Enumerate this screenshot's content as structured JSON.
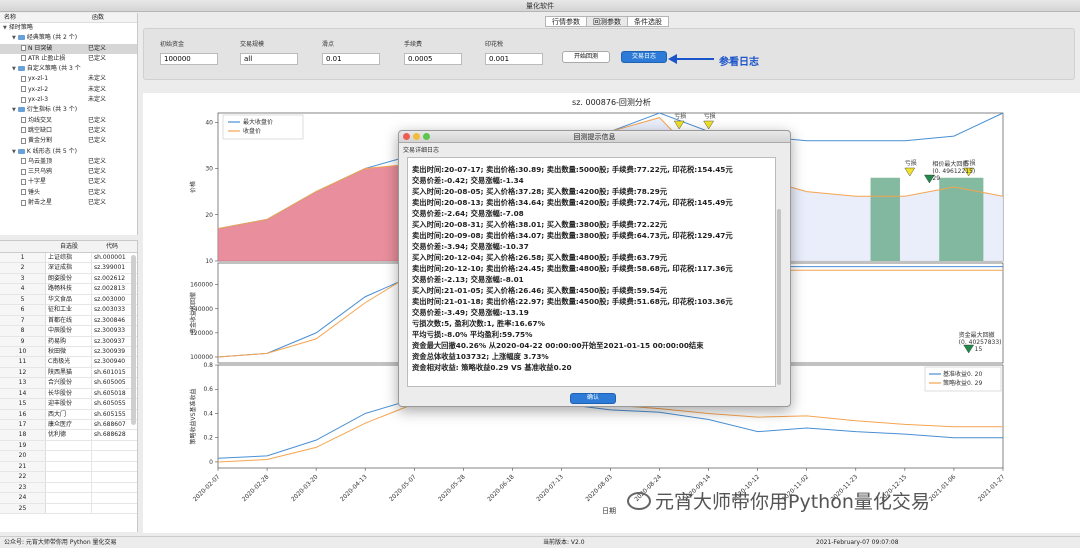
{
  "window": {
    "title": "量化软件"
  },
  "left_tree": {
    "header_name": "名称",
    "header_func": "函数",
    "rows": [
      {
        "level": 0,
        "label": "择时策略",
        "status": "",
        "folder": false,
        "arrow": "▼"
      },
      {
        "level": 1,
        "label": "经典策略 (共 2 个)",
        "status": "",
        "folder": true,
        "arrow": "▼"
      },
      {
        "level": 2,
        "label": "N 日突破",
        "status": "已定义",
        "folder": false,
        "arrow": ""
      },
      {
        "level": 2,
        "label": "ATR 止盈止损",
        "status": "已定义",
        "folder": false,
        "arrow": ""
      },
      {
        "level": 1,
        "label": "自定义策略 (共 3 个",
        "status": "",
        "folder": true,
        "arrow": "▼"
      },
      {
        "level": 2,
        "label": "yx-zl-1",
        "status": "未定义",
        "folder": false,
        "arrow": ""
      },
      {
        "level": 2,
        "label": "yx-zl-2",
        "status": "未定义",
        "folder": false,
        "arrow": ""
      },
      {
        "level": 2,
        "label": "yx-zl-3",
        "status": "未定义",
        "folder": false,
        "arrow": ""
      },
      {
        "level": 1,
        "label": "衍生指标 (共 3 个)",
        "status": "",
        "folder": true,
        "arrow": "▼"
      },
      {
        "level": 2,
        "label": "均线交叉",
        "status": "已定义",
        "folder": false,
        "arrow": ""
      },
      {
        "level": 2,
        "label": "跳空缺口",
        "status": "已定义",
        "folder": false,
        "arrow": ""
      },
      {
        "level": 2,
        "label": "黄金分割",
        "status": "已定义",
        "folder": false,
        "arrow": ""
      },
      {
        "level": 1,
        "label": "K 线形态 (共 5 个)",
        "status": "",
        "folder": true,
        "arrow": "▼"
      },
      {
        "level": 2,
        "label": "乌云盖顶",
        "status": "已定义",
        "folder": false,
        "arrow": ""
      },
      {
        "level": 2,
        "label": "三只乌鸦",
        "status": "已定义",
        "folder": false,
        "arrow": ""
      },
      {
        "level": 2,
        "label": "十字星",
        "status": "已定义",
        "folder": false,
        "arrow": ""
      },
      {
        "level": 2,
        "label": "锤头",
        "status": "已定义",
        "folder": false,
        "arrow": ""
      },
      {
        "level": 2,
        "label": "射击之星",
        "status": "已定义",
        "folder": false,
        "arrow": ""
      }
    ]
  },
  "stock_table": {
    "col_stock": "自选股",
    "col_code": "代码",
    "rows": [
      {
        "n": "1",
        "name": "上证综指",
        "code": "sh.000001"
      },
      {
        "n": "2",
        "name": "深证成指",
        "code": "sz.399001"
      },
      {
        "n": "3",
        "name": "朗姿股份",
        "code": "sz.002612"
      },
      {
        "n": "4",
        "name": "路畅科技",
        "code": "sz.002813"
      },
      {
        "n": "5",
        "name": "华文食品",
        "code": "sz.003000"
      },
      {
        "n": "6",
        "name": "征和工业",
        "code": "sz.003033"
      },
      {
        "n": "7",
        "name": "首都在线",
        "code": "sz.300846"
      },
      {
        "n": "8",
        "name": "中辰股份",
        "code": "sz.300933"
      },
      {
        "n": "9",
        "name": "药易购",
        "code": "sz.300937"
      },
      {
        "n": "10",
        "name": "秋田微",
        "code": "sz.300939"
      },
      {
        "n": "11",
        "name": "C南极光",
        "code": "sz.300940"
      },
      {
        "n": "12",
        "name": "陕西黑猫",
        "code": "sh.601015"
      },
      {
        "n": "13",
        "name": "合兴股份",
        "code": "sh.605005"
      },
      {
        "n": "14",
        "name": "长华股份",
        "code": "sh.605018"
      },
      {
        "n": "15",
        "name": "迎丰股份",
        "code": "sh.605055"
      },
      {
        "n": "16",
        "name": "西大门",
        "code": "sh.605155"
      },
      {
        "n": "17",
        "name": "康众医疗",
        "code": "sh.688607"
      },
      {
        "n": "18",
        "name": "优利德",
        "code": "sh.688628"
      },
      {
        "n": "19",
        "name": "",
        "code": ""
      },
      {
        "n": "20",
        "name": "",
        "code": ""
      },
      {
        "n": "21",
        "name": "",
        "code": ""
      },
      {
        "n": "22",
        "name": "",
        "code": ""
      },
      {
        "n": "23",
        "name": "",
        "code": ""
      },
      {
        "n": "24",
        "name": "",
        "code": ""
      },
      {
        "n": "25",
        "name": "",
        "code": ""
      }
    ]
  },
  "tabs": [
    {
      "label": "行情参数",
      "active": false
    },
    {
      "label": "回测参数",
      "active": true
    },
    {
      "label": "条件选股",
      "active": false
    }
  ],
  "params": {
    "initial_capital": {
      "label": "初始资金",
      "value": "100000"
    },
    "trade_scale": {
      "label": "交易规模",
      "value": "all"
    },
    "slippage": {
      "label": "滑点",
      "value": "0.01"
    },
    "fee": {
      "label": "手续费",
      "value": "0.0005"
    },
    "stamp_tax": {
      "label": "印花税",
      "value": "0.001"
    },
    "start_button": "开始回测",
    "log_button": "交易日志",
    "annotation": "参看日志"
  },
  "chart": {
    "title": "sz. 000876-回测分析",
    "ylabel_top": "价格",
    "ylabel_mid": "资金收益和回撤",
    "ylabel_bot": "策略收益VS基准收益",
    "xlabel": "日期",
    "legend_top": [
      "最大收盘价",
      "收盘价"
    ],
    "legend_bot": [
      "基准收益0. 20",
      "策略收益0. 29"
    ],
    "annotations": {
      "buy1": "买利",
      "sell1": "亏损",
      "sell2": "亏损",
      "sell3": "亏损",
      "sell4": "亏损",
      "max_drawdown": "相价最大回撤",
      "max_drawdown_val": "(0. 49612215)",
      "max_drawdown_val2": "29",
      "cap_drawdown": "资金最大回撤",
      "cap_drawdown_val": "(0. 40257833)",
      "cap_drawdown_val2": "15"
    },
    "colors": {
      "max_close": "#4a8fd4",
      "close": "#f5a450",
      "fill_red": "#e47a8c",
      "fill_green": "#6fae8e"
    }
  },
  "chart_data": {
    "type": "line",
    "x": [
      "2020-02-07",
      "2020-02-28",
      "2020-03-20",
      "2020-04-13",
      "2020-05-07",
      "2020-05-28",
      "2020-06-18",
      "2020-07-13",
      "2020-08-03",
      "2020-08-24",
      "2020-09-14",
      "2020-10-12",
      "2020-11-02",
      "2020-11-23",
      "2020-12-15",
      "2021-01-06",
      "2021-01-27"
    ],
    "top_panel": {
      "yticks": [
        10,
        20,
        30,
        40
      ],
      "series": [
        {
          "name": "最大收盘价",
          "values": [
            17,
            19,
            25,
            30,
            33,
            34,
            35,
            36,
            38,
            42,
            38,
            37,
            36,
            36,
            36,
            37,
            42
          ]
        },
        {
          "name": "收盘价",
          "values": [
            17,
            19,
            25,
            30,
            31,
            32,
            33,
            34,
            38,
            41,
            30,
            28,
            25,
            24,
            24,
            26,
            24
          ]
        }
      ]
    },
    "mid_panel": {
      "yticks": [
        100000,
        120000,
        140000,
        160000
      ],
      "series": [
        {
          "name": "资金收益",
          "values": [
            100000,
            103000,
            120000,
            150000,
            168000,
            175000,
            175000,
            175000,
            175000,
            175000,
            175000,
            175000,
            175000,
            175000,
            175000,
            175000,
            175000
          ]
        },
        {
          "name": "回撤",
          "values": [
            100000,
            103000,
            115000,
            145000,
            170000,
            172000,
            172000,
            172000,
            172000,
            172000,
            172000,
            172000,
            172000,
            172000,
            172000,
            172000,
            172000
          ]
        }
      ]
    },
    "bottom_panel": {
      "yticks": [
        0.0,
        0.2,
        0.4,
        0.6,
        0.8
      ],
      "series": [
        {
          "name": "基准收益0. 20",
          "values": [
            0.03,
            0.05,
            0.18,
            0.4,
            0.52,
            0.55,
            0.5,
            0.48,
            0.43,
            0.41,
            0.35,
            0.25,
            0.28,
            0.25,
            0.23,
            0.2,
            0.2
          ]
        },
        {
          "name": "策略收益0. 29",
          "values": [
            0.0,
            0.02,
            0.12,
            0.32,
            0.48,
            0.52,
            0.48,
            0.49,
            0.47,
            0.44,
            0.4,
            0.37,
            0.38,
            0.34,
            0.31,
            0.29,
            0.29
          ]
        }
      ]
    }
  },
  "dialog": {
    "title": "回测提示信息",
    "subtitle": "交易详细日志",
    "lines": [
      "卖出时间:20-07-17; 卖出价格:30.89; 卖出数量:5000股; 手续费:77.22元, 印花税:154.45元",
      "交易价差:-0.42; 交易涨幅:-1.34",
      "买入时间:20-08-05; 买入价格:37.28; 买入数量:4200股; 手续费:78.29元",
      "卖出时间:20-08-13; 卖出价格:34.64; 卖出数量:4200股; 手续费:72.74元, 印花税:145.49元",
      "交易价差:-2.64; 交易涨幅:-7.08",
      "买入时间:20-08-31; 买入价格:38.01; 买入数量:3800股; 手续费:72.22元",
      "卖出时间:20-09-08; 卖出价格:34.07; 卖出数量:3800股; 手续费:64.73元, 印花税:129.47元",
      "交易价差:-3.94; 交易涨幅:-10.37",
      "买入时间:20-12-04; 买入价格:26.58; 买入数量:4800股; 手续费:63.79元",
      "卖出时间:20-12-10; 卖出价格:24.45; 卖出数量:4800股; 手续费:58.68元, 印花税:117.36元",
      "交易价差:-2.13; 交易涨幅:-8.01",
      "买入时间:21-01-05; 买入价格:26.46; 买入数量:4500股; 手续费:59.54元",
      "卖出时间:21-01-18; 卖出价格:22.97; 卖出数量:4500股; 手续费:51.68元, 印花税:103.36元",
      "交易价差:-3.49; 交易涨幅:-13.19",
      "亏损次数:5, 盈利次数:1, 胜率:16.67%",
      "平均亏损:-8.0% 平均盈利:59.75%",
      "资金最大回撤40.26% 从2020-04-22 00:00:00开始至2021-01-15 00:00:00结束",
      "资金总体收益103732; 上涨幅度 3.73%",
      "资金相对收益: 策略收益0.29 VS 基准收益0.20"
    ],
    "ok_button": "确认"
  },
  "statusbar": {
    "left": "公众号: 元宵大师带你用 Python 量化交易",
    "center": "当前版本: V2.0",
    "right": "2021-February-07 09:07:08"
  },
  "watermark": "元宵大师带你用Python量化交易"
}
